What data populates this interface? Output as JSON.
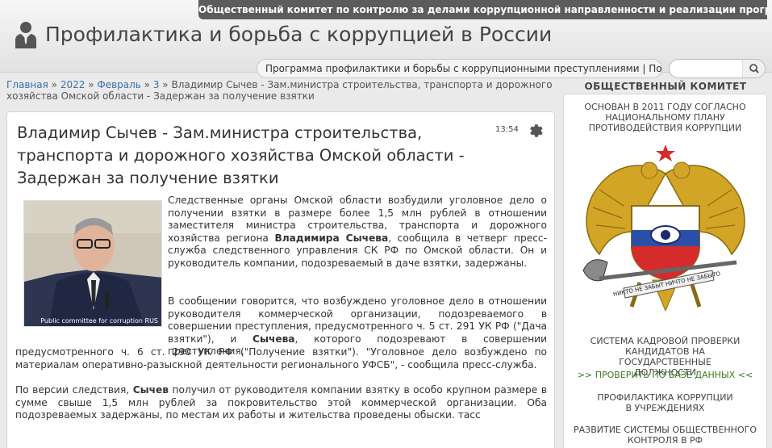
{
  "header": {
    "top_strip": "Общественный комитет по контролю за делами коррупционной направленности и реализации программы Президента РФ",
    "site_title": "Профилактика и борьба с коррупцией в России",
    "program_bar": "Программа профилактики и борьбы с коррупционными преступлениями | Поиск в БД:",
    "search_placeholder": ""
  },
  "breadcrumb": {
    "home": "Главная",
    "sep": " » ",
    "year": "2022",
    "month": "Февраль",
    "day": "3",
    "current": "Владимир Сычев - Зам.министра строительства, транспорта и дорожного хозяйства Омской области - Задержан за получение взятки"
  },
  "article": {
    "title": "Владимир Сычев - Зам.министра строительства, транспорта и дорожного хозяйства Омской области - Задержан за получение взятки",
    "time": "13:54",
    "photo_caption": "Public committee for corruption RUS",
    "p1_a": "Следственные органы Омской области возбудили уголовное дело о получении взятки в размере более 1,5 млн рублей в отношении заместителя министра строительства, транспорта и дорожного хозяйства региона ",
    "p1_b": "Владимира Сычева",
    "p1_c": ", сообщила в четверг пресс-служба следственного управления СК РФ по Омской области. Он и руководитель компании, подозреваемый в даче взятки, задержаны.",
    "p2_a": "В сообщении говорится, что возбуждено уголовное дело в отношении руководителя коммерческой организации, подозреваемого в совершении преступления, предусмотренного ч. 5 ст. 291 УК РФ (\"Дача взятки\"), и",
    "p2_b": "Сычева",
    "p2_c": ", которого подозревают в совершении преступления,",
    "p2_d": "предусмотренного ч. 6 ст. 290 УК РФ (\"Получение взятки\"). \"Уголовное дело возбуждено по материалам оперативно-разыскной деятельности регионального УФСБ\", - сообщила пресс-служба.",
    "p3_a": "По версии следствия, ",
    "p3_b": "Сычев",
    "p3_c": " получил от руководителя компании взятку в особо крупном размере в сумме свыше 1,5 млн рублей за покровительство этой коммерческой организации. Оба подозреваемых задержаны, по местам их работы и жительства проведены обыски.  тасс"
  },
  "sidebar": {
    "title": "ОБЩЕСТВЕННЫЙ КОМИТЕТ",
    "founded": "ОСНОВАН В 2011 ГОДУ СОГЛАСНО НАЦИОНАЛЬНОМУ ПЛАНУ ПРОТИВОДЕЙСТВИЯ КОРРУПЦИИ",
    "emblem_motto": "НИКТО НЕ ЗАБЫТ НИЧТО НЕ ЗАБЫТО",
    "system": "СИСТЕМА КАДРОВОЙ ПРОВЕРКИ КАНДИДАТОВ НА ГОСУДАРСТВЕННЫЕ ДОЛЖНОСТИ",
    "check_link": ">> ПРОВЕРИТЬ ПО БАЗЕ ДАННЫХ <<",
    "prevention": "ПРОФИЛАКТИКА КОРРУПЦИИ В УЧРЕЖДЕНИЯХ",
    "public_control": "РАЗВИТИЕ СИСТЕМЫ ОБЩЕСТВЕННОГО КОНТРОЛЯ В РФ"
  },
  "colors": {
    "top_strip_bg": "#5c5c5c",
    "link": "#3a6fb0",
    "sidebar_link": "#3f7a22",
    "emblem_gold": "#d2a526",
    "flag_blue": "#2a4fa8",
    "flag_red": "#d62b2b"
  },
  "icons": {
    "logo": "person-in-suit-icon",
    "search": "search-icon",
    "settings": "gear-icon"
  }
}
